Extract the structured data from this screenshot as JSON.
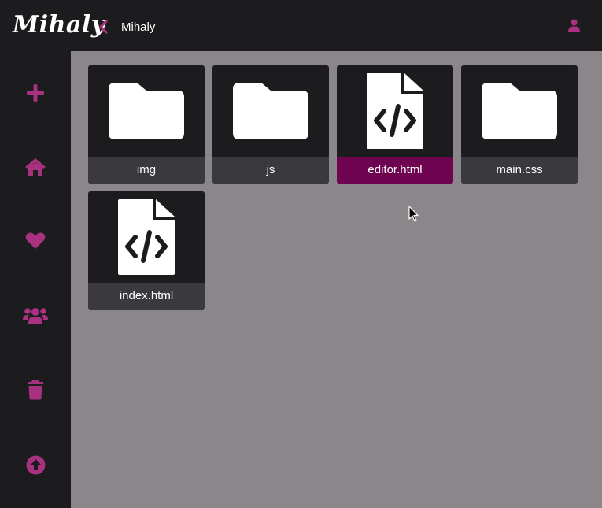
{
  "header": {
    "logo": "Mihaly",
    "breadcrumb": "Mihaly",
    "back_icon": "chevron-left-icon",
    "user_icon": "user-icon"
  },
  "colors": {
    "accent": "#a8327f",
    "selected": "#6e0450",
    "panel": "#1c1b1d",
    "background": "#8b868a",
    "label_bg": "#3a393d"
  },
  "sidebar": {
    "items": [
      {
        "icon": "plus-icon",
        "action": "new"
      },
      {
        "icon": "home-icon",
        "action": "home"
      },
      {
        "icon": "heart-icon",
        "action": "favorites"
      },
      {
        "icon": "users-icon",
        "action": "shared"
      },
      {
        "icon": "trash-icon",
        "action": "trash"
      },
      {
        "icon": "upload-icon",
        "action": "upload"
      }
    ]
  },
  "files": [
    {
      "name": "img",
      "type": "folder",
      "selected": false
    },
    {
      "name": "js",
      "type": "folder",
      "selected": false
    },
    {
      "name": "editor.html",
      "type": "code-file",
      "selected": true
    },
    {
      "name": "main.css",
      "type": "folder",
      "selected": false
    },
    {
      "name": "index.html",
      "type": "code-file",
      "selected": false
    }
  ]
}
